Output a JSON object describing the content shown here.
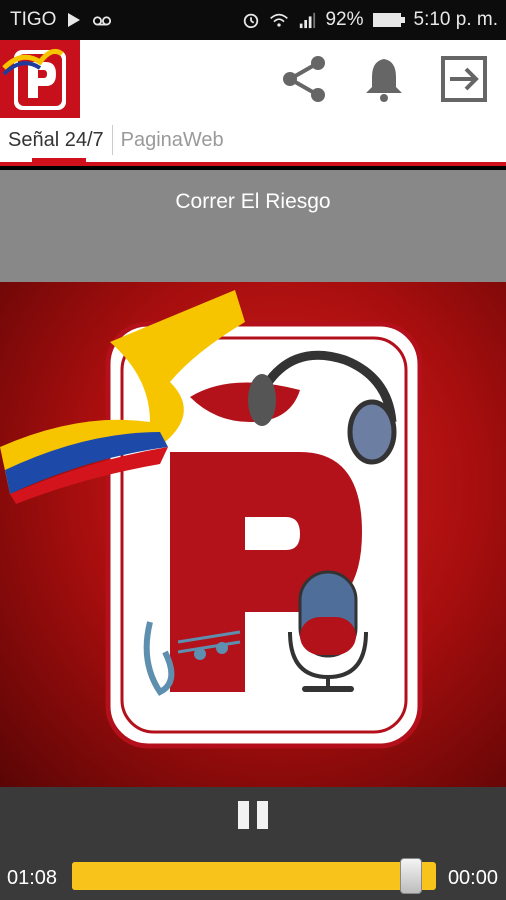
{
  "status_bar": {
    "carrier": "TIGO",
    "battery": "92%",
    "time": "5:10 p. m."
  },
  "tabs": [
    {
      "label": "Señal 24/7"
    },
    {
      "label": "PaginaWeb"
    }
  ],
  "now_playing": {
    "title": "Correr El Riesgo"
  },
  "player": {
    "current_time": "01:08",
    "total_time": "00:00",
    "progress_fraction": 0.93
  },
  "colors": {
    "brand_red": "#d0101b",
    "seek_yellow": "#f8c31a",
    "title_band_gray": "#888888"
  },
  "icons": [
    "play-icon",
    "voicemail-icon",
    "alarm-icon",
    "wifi-icon",
    "signal-icon",
    "battery-icon",
    "share-icon",
    "bell-icon",
    "logout-icon",
    "pause-icon"
  ]
}
